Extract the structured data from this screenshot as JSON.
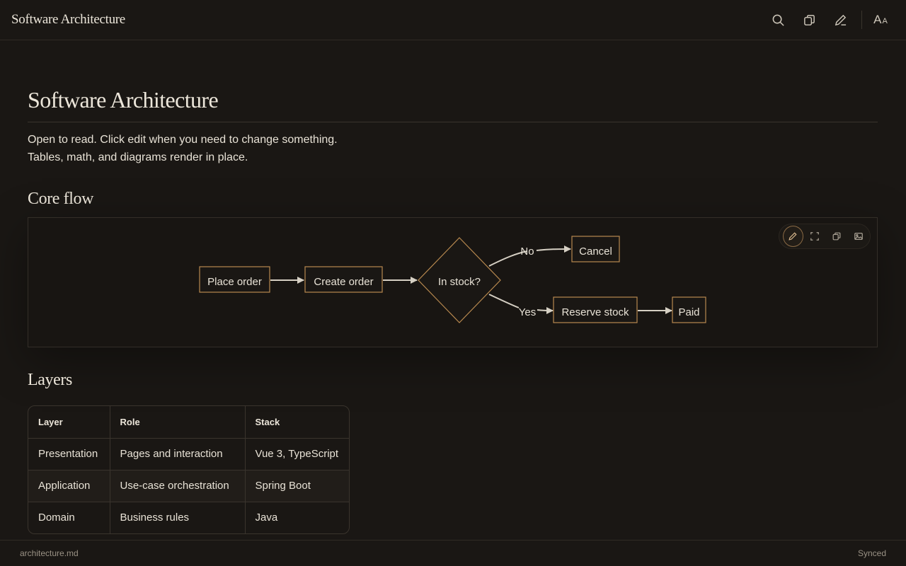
{
  "header": {
    "app_title": "Software Architecture",
    "icons": [
      "search-icon",
      "copy-icon",
      "pencil-icon",
      "font-size-icon"
    ],
    "font_size_big": "A",
    "font_size_small": "A"
  },
  "document": {
    "title": "Software Architecture",
    "paragraph_lines": [
      "Open to read. Click edit when you need to change something.",
      "Tables, math, and diagrams render in place."
    ],
    "sections": {
      "core_flow": "Core flow",
      "layers": "Layers"
    }
  },
  "diagram": {
    "tools": [
      "pencil-icon",
      "fullscreen-icon",
      "copy-icon",
      "image-icon"
    ],
    "nodes": {
      "place_order": "Place order",
      "create_order": "Create order",
      "in_stock": "In stock?",
      "cancel": "Cancel",
      "reserve_stock": "Reserve stock",
      "paid": "Paid"
    },
    "edges": {
      "no": "No",
      "yes": "Yes"
    }
  },
  "table": {
    "headers": [
      "Layer",
      "Role",
      "Stack"
    ],
    "rows": [
      [
        "Presentation",
        "Pages and interaction",
        "Vue 3, TypeScript"
      ],
      [
        "Application",
        "Use-case orchestration",
        "Spring Boot"
      ],
      [
        "Domain",
        "Business rules",
        "Java"
      ]
    ]
  },
  "status": {
    "filename": "architecture.md",
    "sync_state": "Synced"
  },
  "colors": {
    "background": "#1a1714",
    "node_border": "#b8894f",
    "text": "#e8e2d6"
  }
}
